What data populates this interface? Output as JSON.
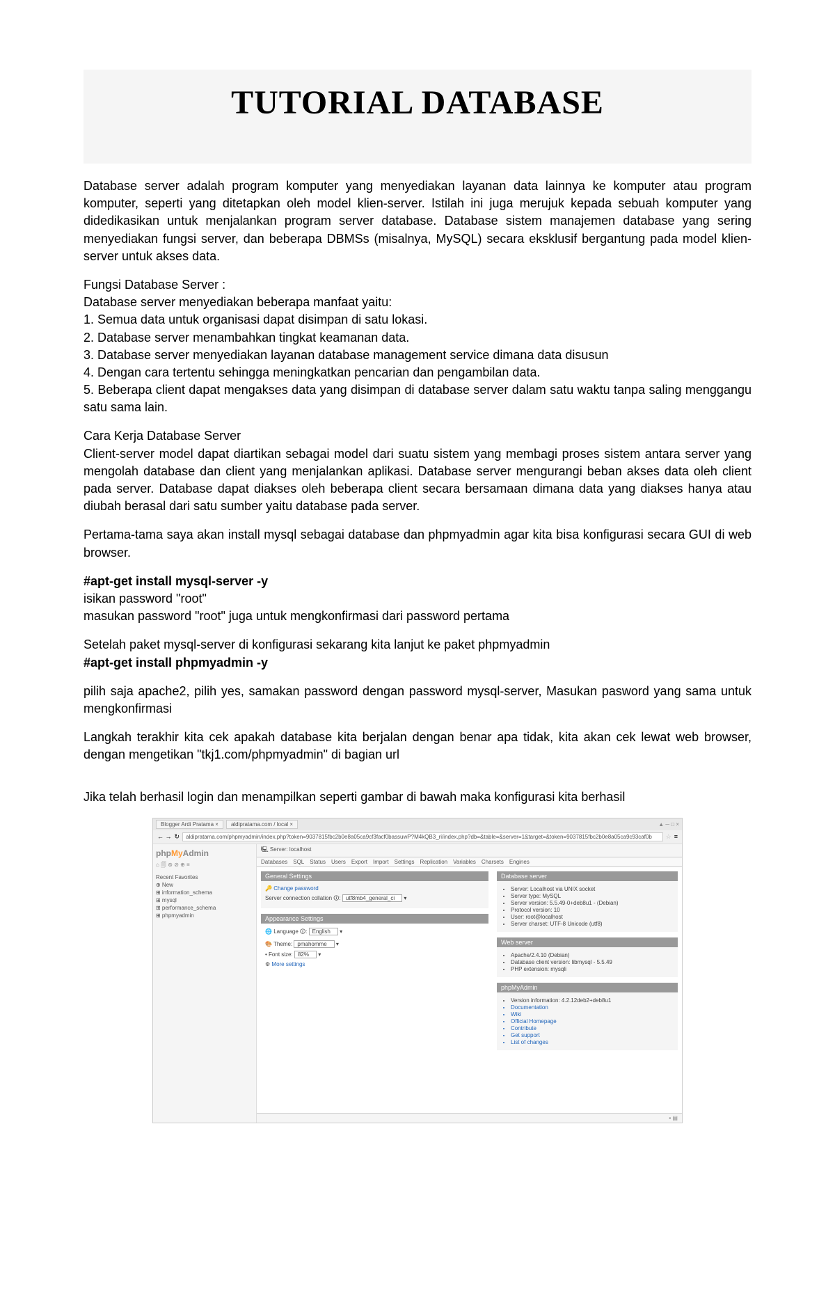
{
  "title": "TUTORIAL DATABASE",
  "intro": "Database server adalah program komputer yang menyediakan layanan data lainnya ke komputer atau program komputer, seperti yang ditetapkan oleh model klien-server. Istilah ini juga merujuk kepada sebuah komputer yang didedikasikan untuk menjalankan program server database. Database sistem manajemen database yang sering menyediakan fungsi server, dan beberapa DBMSs (misalnya, MySQL) secara eksklusif bergantung pada model klien-server untuk akses data.",
  "fungsi_head": "Fungsi Database Server :",
  "fungsi_lead": "Database server menyediakan beberapa manfaat yaitu:",
  "fungsi_items": [
    "1. Semua data untuk organisasi dapat disimpan di satu lokasi.",
    "2. Database server menambahkan tingkat keamanan data.",
    "3. Database server menyediakan layanan database management service dimana data disusun",
    "4. Dengan cara tertentu sehingga meningkatkan pencarian dan pengambilan data.",
    "5. Beberapa client dapat mengakses data yang disimpan di database server dalam satu waktu tanpa saling menggangu satu sama lain."
  ],
  "cara_head": "Cara Kerja Database Server",
  "cara_body": "Client-server model dapat diartikan sebagai model dari suatu sistem yang membagi proses sistem antara server yang mengolah database dan client yang menjalankan aplikasi. Database server mengurangi beban akses data oleh client pada server. Database dapat diakses oleh beberapa client secara bersamaan dimana data yang diakses hanya atau diubah berasal dari satu sumber yaitu database pada server.",
  "install_lead": "Pertama-tama saya akan install mysql sebagai database dan phpmyadmin agar kita bisa konfigurasi secara GUI di web browser.",
  "cmd1": "#apt-get install mysql-server -y",
  "cmd1_note1": "isikan password \"root\"",
  "cmd1_note2": "masukan password \"root\" juga untuk mengkonfirmasi dari password pertama",
  "cmd2_lead": "Setelah paket mysql-server di konfigurasi sekarang kita lanjut ke paket phpmyadmin",
  "cmd2": "#apt-get install phpmyadmin -y",
  "cmd2_note": "pilih saja apache2, pilih yes, samakan password dengan password mysql-server, Masukan pasword yang sama untuk mengkonfirmasi",
  "check_text": "Langkah terakhir kita cek apakah database kita berjalan dengan benar apa tidak, kita akan cek lewat web browser, dengan mengetikan \"tkj1.com/phpmyadmin\" di bagian url",
  "result_text": "Jika telah berhasil login dan menampilkan seperti gambar di bawah maka konfigurasi kita berhasil",
  "screenshot": {
    "tabs": [
      "Blogger Ardi Pratama ×",
      "aldipratama.com / local ×"
    ],
    "win_ctrl": "▲ ─ □ ×",
    "nav_arrows": "← →",
    "nav_reload": "↻",
    "url": "aldipratama.com/phpmyadmin/index.php?token=9037815fbc2b0e8a05ca9cf3facf0bassuwP?M4kQB3_ri/index.php?db=&table=&server=1&target=&token=9037815fbc2b0e8a05ca9c93caf0b",
    "logo": {
      "php": "php",
      "my": "My",
      "admin": "Admin"
    },
    "sb_icons": "⌂ 🗐 ⊚ ⊘ ⊕ ≡",
    "sb_recent": "Recent  Favorites",
    "sb_new": "⊕ New",
    "sb_items": [
      "⊞ information_schema",
      "⊞ mysql",
      "⊞ performance_schema",
      "⊞ phpmyadmin"
    ],
    "crumb": "🖳 Server: localhost",
    "main_tabs": [
      "Databases",
      "SQL",
      "Status",
      "Users",
      "Export",
      "Import",
      "Settings",
      "Replication",
      "Variables",
      "Charsets",
      "Engines"
    ],
    "gen_head": "General Settings",
    "gen_change_pw": "Change password",
    "gen_collation_label": "Server connection collation",
    "gen_collation_val": "utf8mb4_general_ci",
    "app_head": "Appearance Settings",
    "app_lang_label": "Language",
    "app_lang_val": "English",
    "app_theme_label": "Theme",
    "app_theme_val": "pmahomme",
    "app_font_label": "Font size:",
    "app_font_val": "82%",
    "app_more": "More settings",
    "db_head": "Database server",
    "db_items": [
      "Server: Localhost via UNIX socket",
      "Server type: MySQL",
      "Server version: 5.5.49-0+deb8u1 - (Debian)",
      "Protocol version: 10",
      "User: root@localhost",
      "Server charset: UTF-8 Unicode (utf8)"
    ],
    "web_head": "Web server",
    "web_items": [
      "Apache/2.4.10 (Debian)",
      "Database client version: libmysql - 5.5.49",
      "PHP extension: mysqli"
    ],
    "pma_head": "phpMyAdmin",
    "pma_items": [
      "Version information: 4.2.12deb2+deb8u1",
      "Documentation",
      "Wiki",
      "Official Homepage",
      "Contribute",
      "Get support",
      "List of changes"
    ],
    "console": "▪ ▤"
  }
}
